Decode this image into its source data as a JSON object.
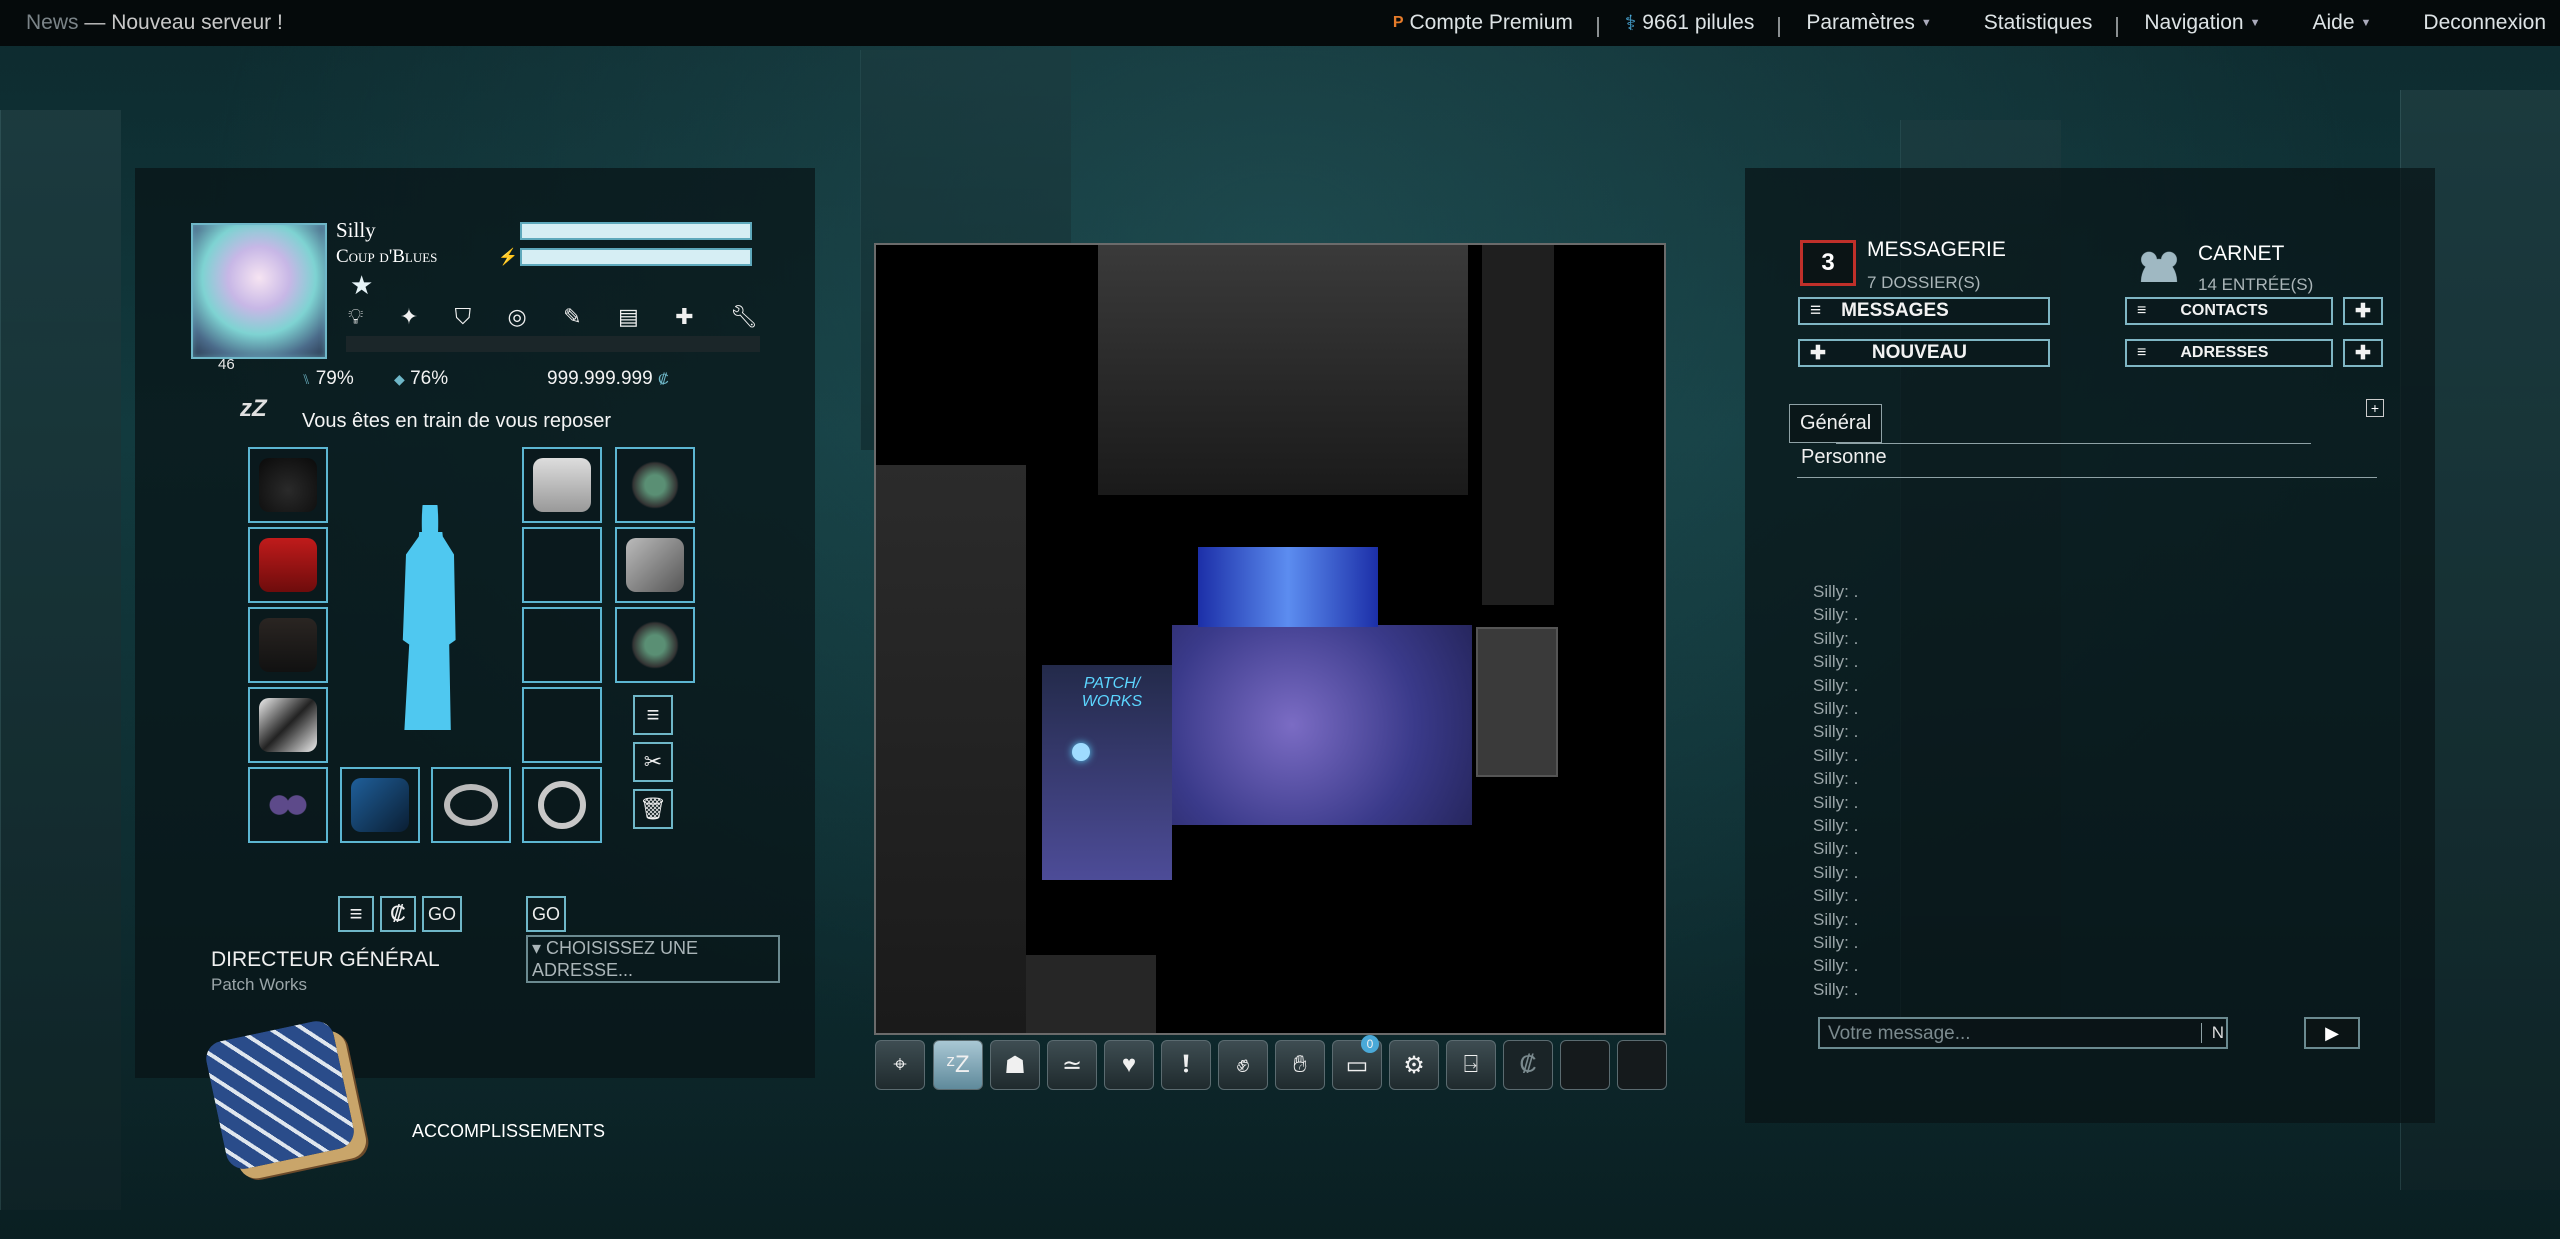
{
  "topbar": {
    "news_tag": "News",
    "news_text": "— Nouveau serveur !",
    "premium": "Compte Premium",
    "pills": "9661 pilules",
    "settings": "Paramètres",
    "stats": "Statistiques",
    "navigation": "Navigation",
    "help": "Aide",
    "logout": "Deconnexion"
  },
  "character": {
    "name": "Silly",
    "clan": "Coup d'Blues",
    "level": "46",
    "stat1": "79%",
    "stat2": "76%",
    "money": "999.999.999",
    "status": "Vous êtes en train de vous reposer",
    "sleep": "zZ",
    "bar1_fill": 1.0,
    "bar2_fill": 1.0
  },
  "job": {
    "title": "DIRECTEUR GÉNÉRAL",
    "company": "Patch Works",
    "go1": "GO",
    "go2": "GO",
    "address_placeholder": "▾ CHOISISSEZ UNE ADRESSE..."
  },
  "achievements": "ACCOMPLISSEMENTS",
  "map": {
    "sign": "PATCH/ WORKS"
  },
  "toolbar": {
    "badge": "0"
  },
  "messaging": {
    "count": "3",
    "title": "MESSAGERIE",
    "folders": "7 DOSSIER(S)",
    "messages_btn": "MESSAGES",
    "new_btn": "NOUVEAU"
  },
  "carnet": {
    "title": "CARNET",
    "entries": "14 ENTRÉE(S)",
    "contacts_btn": "CONTACTS",
    "addresses_btn": "ADRESSES"
  },
  "chat": {
    "tab_general": "Général",
    "channel": "Personne",
    "lines": [
      "Silly: .",
      "Silly: .",
      "Silly: .",
      "Silly: .",
      "Silly: .",
      "Silly: .",
      "Silly: .",
      "Silly: .",
      "Silly: .",
      "Silly: .",
      "Silly: .",
      "Silly: .",
      "Silly: .",
      "Silly: .",
      "Silly: .",
      "Silly: .",
      "Silly: .",
      "Silly: ."
    ],
    "input_placeholder": "Votre message...",
    "n_btn": "N",
    "send_btn": "▶"
  },
  "colors": {
    "accent": "#6fb7c8",
    "bar_fill": "#d6eef4",
    "silhouette": "#4fc8f0"
  }
}
